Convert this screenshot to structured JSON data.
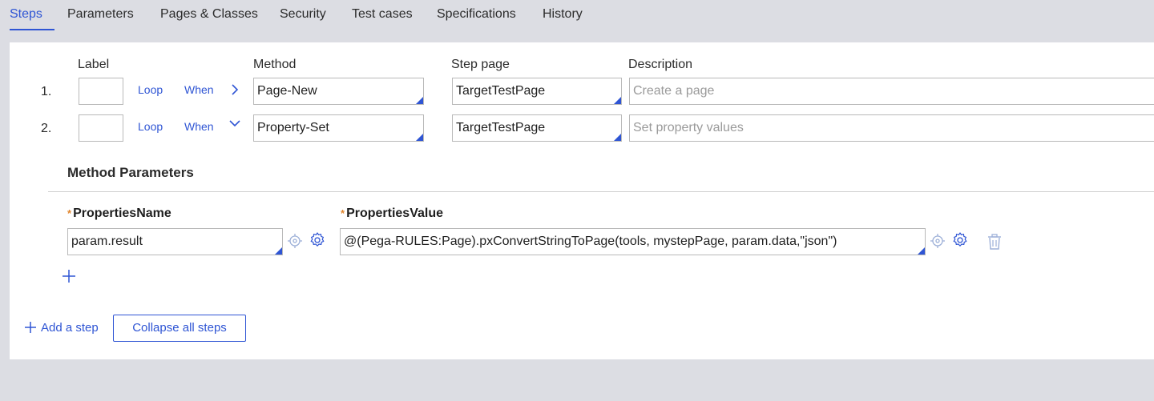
{
  "tabs": [
    {
      "label": "Steps",
      "active": true
    },
    {
      "label": "Parameters"
    },
    {
      "label": "Pages & Classes"
    },
    {
      "label": "Security"
    },
    {
      "label": "Test cases"
    },
    {
      "label": "Specifications"
    },
    {
      "label": "History"
    }
  ],
  "columns": {
    "label": "Label",
    "method": "Method",
    "step_page": "Step page",
    "description": "Description"
  },
  "steps": [
    {
      "number": "1.",
      "loop": "Loop",
      "when": "When",
      "expander": "chevron-right-icon",
      "method": "Page-New",
      "step_page": "TargetTestPage",
      "description_placeholder": "Create a page"
    },
    {
      "number": "2.",
      "loop": "Loop",
      "when": "When",
      "expander": "chevron-down-icon",
      "method": "Property-Set",
      "step_page": "TargetTestPage",
      "description_placeholder": "Set property values"
    }
  ],
  "method_parameters": {
    "title": "Method Parameters",
    "required_marker": "*",
    "name_header": "PropertiesName",
    "value_header": "PropertiesValue",
    "rows": [
      {
        "name": "param.result",
        "value": "@(Pega-RULES:Page).pxConvertStringToPage(tools, mystepPage, param.data,\"json\")"
      }
    ]
  },
  "actions": {
    "add_step": "Add a step",
    "collapse_all": "Collapse all steps"
  },
  "colors": {
    "accent": "#2f55d4",
    "required": "#e1862e",
    "background": "#dcdde3"
  }
}
